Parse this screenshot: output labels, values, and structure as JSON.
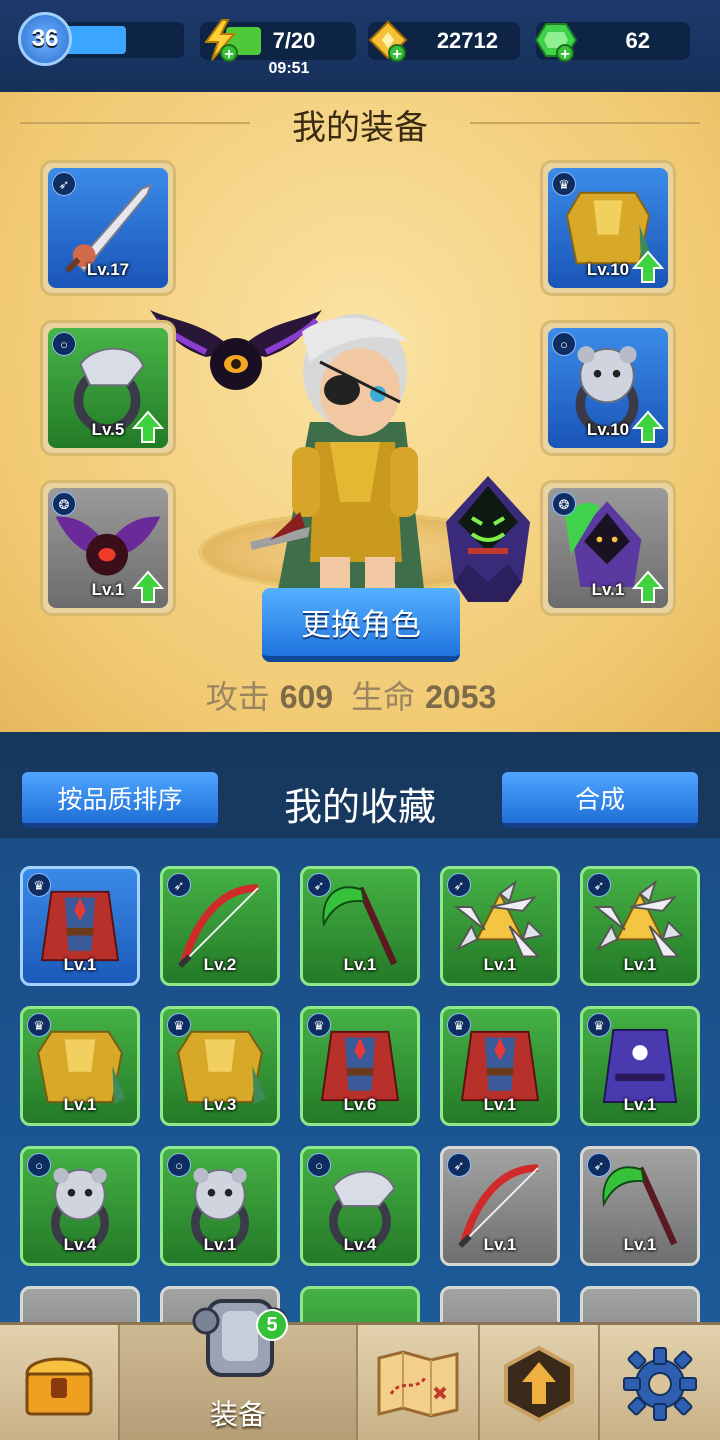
{
  "top": {
    "level": "36",
    "xp_fraction": 0.55,
    "energy": "7/20",
    "energy_fraction": 0.35,
    "energy_timer": "09:51",
    "gold": "22712",
    "gems": "62"
  },
  "equipment": {
    "title": "我的装备",
    "slots": [
      {
        "type": "bow-icon",
        "level": "Lv.17",
        "quality": "blue",
        "upgrade": false
      },
      {
        "type": "armor-icon",
        "level": "Lv.10",
        "quality": "blue",
        "upgrade": true
      },
      {
        "type": "ring-icon",
        "level": "Lv.5",
        "quality": "green",
        "upgrade": true
      },
      {
        "type": "ring-icon",
        "level": "Lv.10",
        "quality": "blue",
        "upgrade": true
      },
      {
        "type": "paw-icon",
        "level": "Lv.1",
        "quality": "gray",
        "upgrade": true
      },
      {
        "type": "paw-icon",
        "level": "Lv.1",
        "quality": "gray",
        "upgrade": true
      }
    ],
    "change_hero_label": "更换角色",
    "attack_label": "攻击",
    "attack_value": "609",
    "hp_label": "生命",
    "hp_value": "2053"
  },
  "collection": {
    "title": "我的收藏",
    "sort_label": "按品质排序",
    "merge_label": "合成",
    "items": [
      {
        "name": "red-cape",
        "level": "Lv.1",
        "quality": "blue"
      },
      {
        "name": "red-bow",
        "level": "Lv.2",
        "quality": "green"
      },
      {
        "name": "green-scythe",
        "level": "Lv.1",
        "quality": "green"
      },
      {
        "name": "silver-spinner",
        "level": "Lv.1",
        "quality": "green"
      },
      {
        "name": "silver-spinner",
        "level": "Lv.1",
        "quality": "green"
      },
      {
        "name": "gold-armor",
        "level": "Lv.1",
        "quality": "green"
      },
      {
        "name": "gold-armor",
        "level": "Lv.3",
        "quality": "green"
      },
      {
        "name": "red-cape",
        "level": "Lv.6",
        "quality": "green"
      },
      {
        "name": "red-cape",
        "level": "Lv.1",
        "quality": "green"
      },
      {
        "name": "purple-robe",
        "level": "Lv.1",
        "quality": "green"
      },
      {
        "name": "bear-ring",
        "level": "Lv.4",
        "quality": "green"
      },
      {
        "name": "bear-ring",
        "level": "Lv.1",
        "quality": "green"
      },
      {
        "name": "eagle-ring",
        "level": "Lv.4",
        "quality": "green"
      },
      {
        "name": "red-bow",
        "level": "Lv.1",
        "quality": "gray"
      },
      {
        "name": "green-scythe",
        "level": "Lv.1",
        "quality": "gray"
      }
    ]
  },
  "nav": {
    "equip_label": "装备",
    "equip_badge": "5"
  }
}
